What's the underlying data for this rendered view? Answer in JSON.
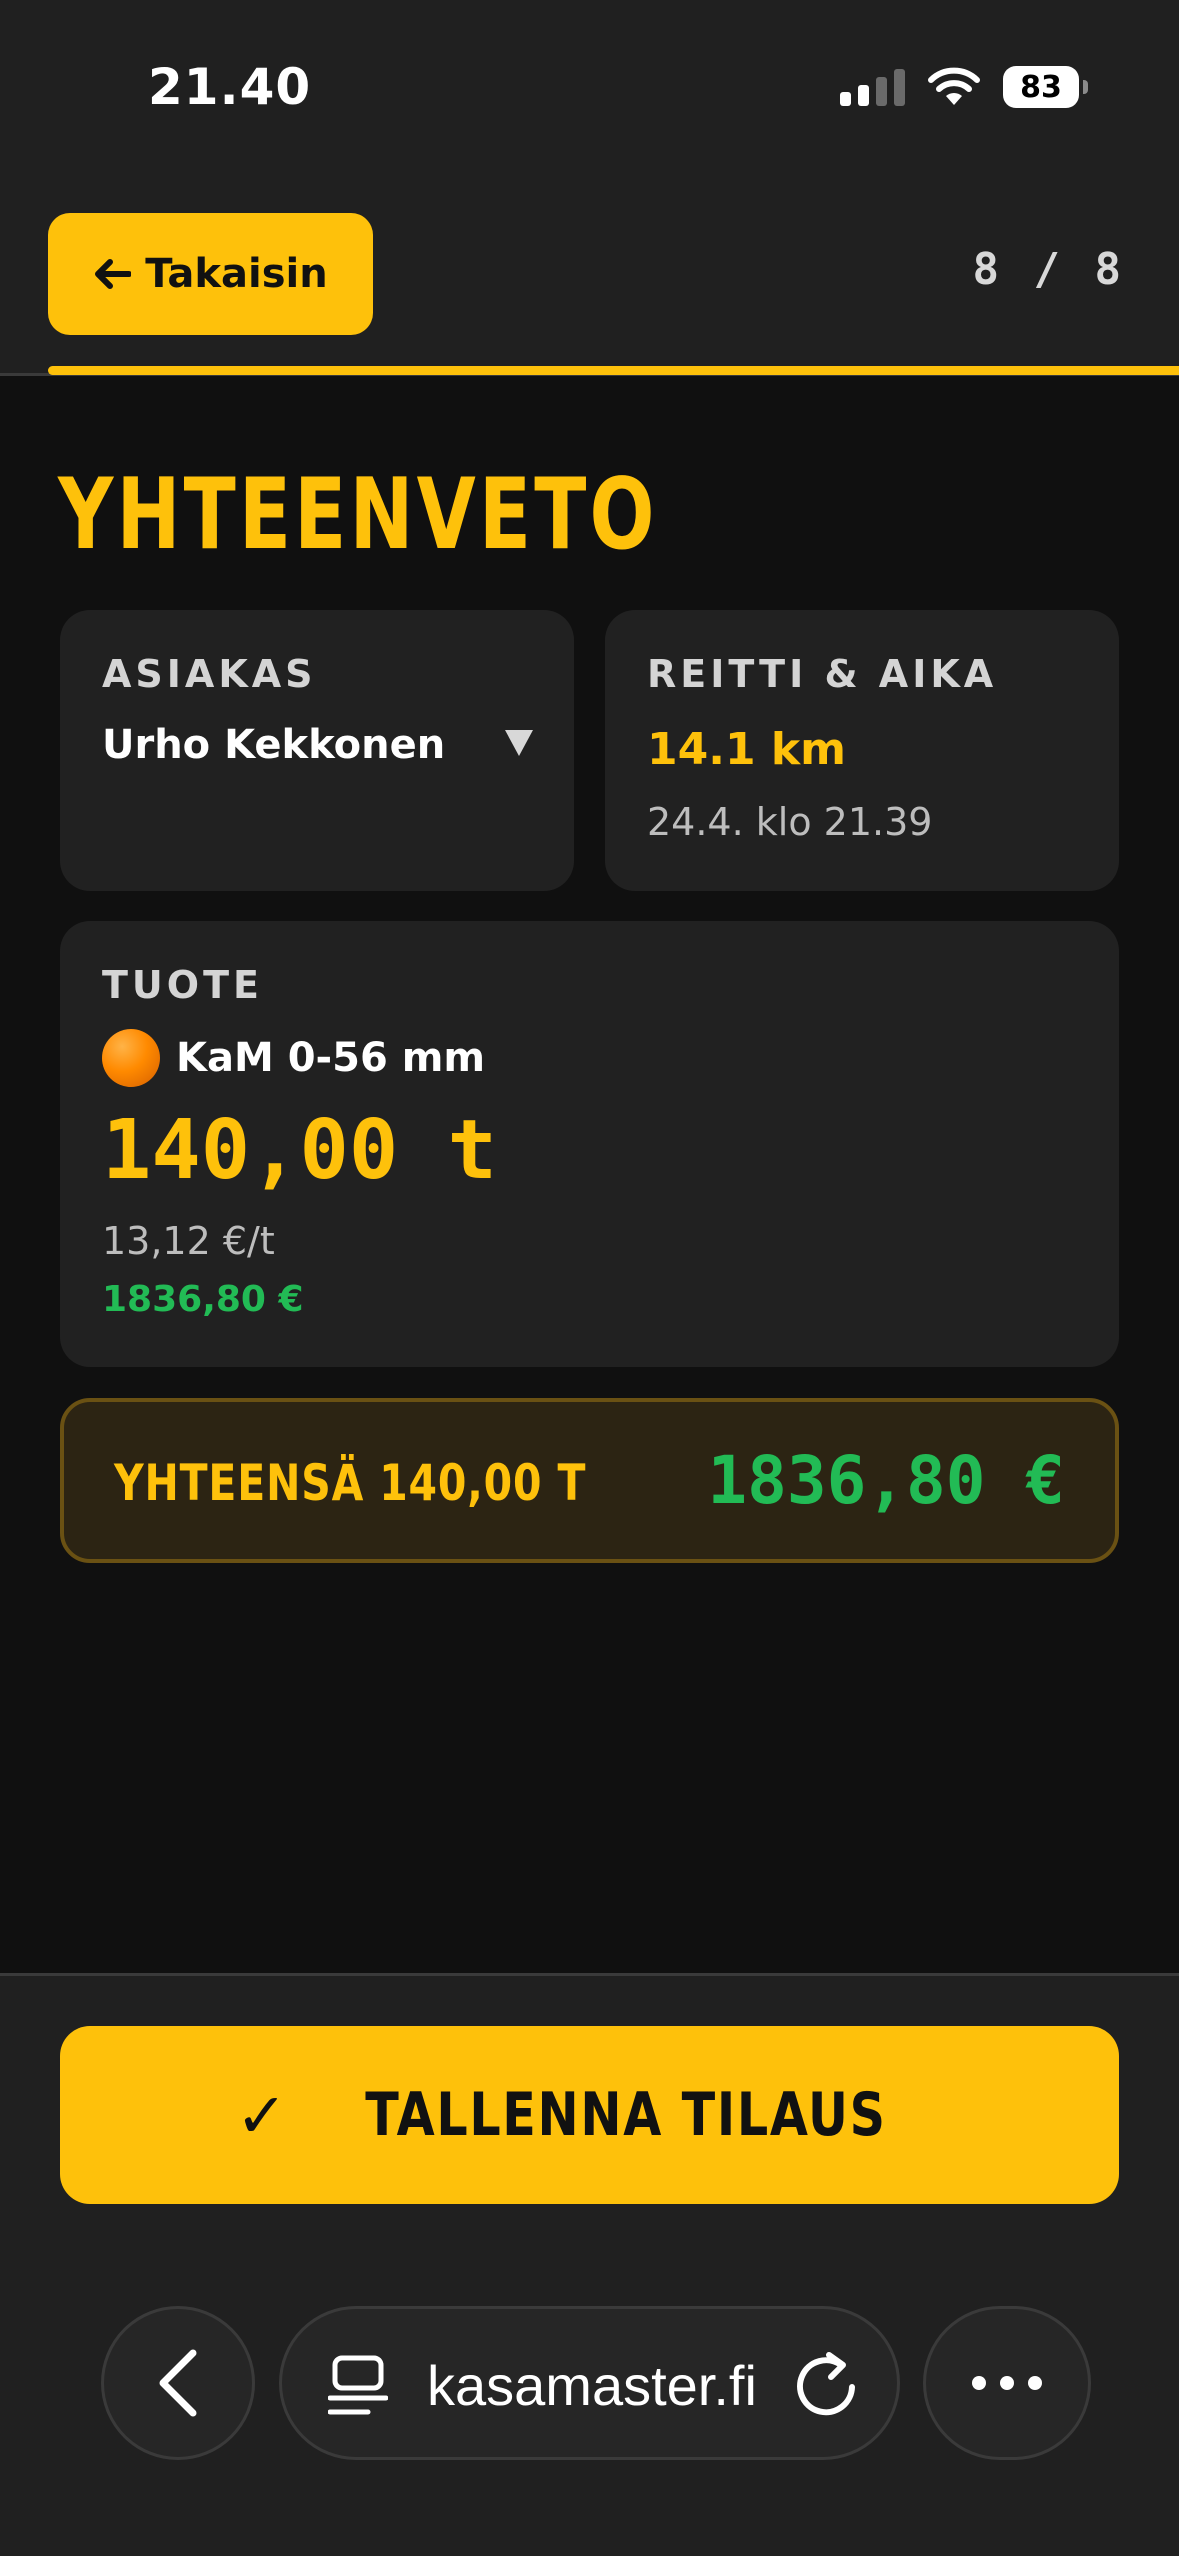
{
  "status_bar": {
    "time": "21.40",
    "battery": "83"
  },
  "header": {
    "back_label": "Takaisin",
    "step": "8 / 8"
  },
  "page": {
    "title": "YHTEENVETO"
  },
  "customer": {
    "label": "ASIAKAS",
    "name": "Urho Kekkonen"
  },
  "route": {
    "label": "REITTI & AIKA",
    "distance": "14.1 km",
    "time": "24.4. klo 21.39"
  },
  "product": {
    "label": "TUOTE",
    "name": "KaM 0-56 mm",
    "quantity": "140,00 t",
    "unit_price": "13,12 €/t",
    "total": "1836,80 €"
  },
  "summary": {
    "label": "YHTEENSÄ 140,00 T",
    "amount": "1836,80 €"
  },
  "actions": {
    "save_check": "✓",
    "save_label": "TALLENNA TILAUS"
  },
  "browser": {
    "url": "kasamaster.fi"
  },
  "colors": {
    "accent": "#fec10b",
    "success": "#22bb55",
    "background": "#101010",
    "card": "#212121"
  },
  "icons": {
    "back": "arrow-left-icon",
    "dropdown": "triangle-down-icon",
    "product": "orange-circle-icon",
    "nav_back": "chevron-left-icon",
    "tabs": "tabs-icon",
    "reload": "reload-icon",
    "more": "more-icon"
  }
}
